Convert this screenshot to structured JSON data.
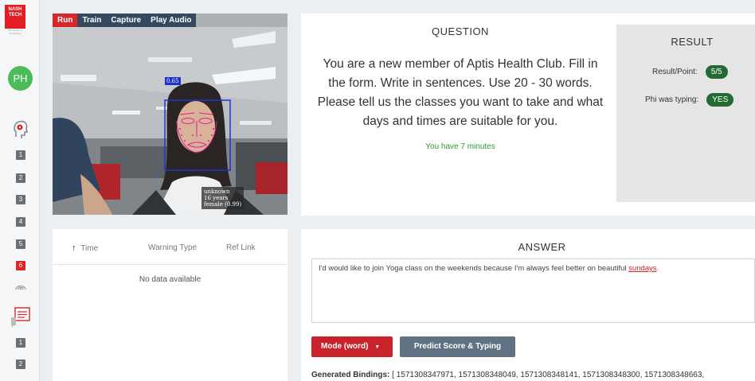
{
  "brand": {
    "logo_line1": "NASH",
    "logo_line2": "TECH",
    "tagline": "The Power of Technology"
  },
  "user": {
    "initials": "PH"
  },
  "sidebar": {
    "group1": [
      "1",
      "2",
      "3",
      "4",
      "5",
      "6"
    ],
    "group1_active": "6",
    "group2": [
      "1",
      "2"
    ]
  },
  "video": {
    "toolbar": [
      "Run",
      "Train",
      "Capture",
      "Play Audio"
    ],
    "face_score": "0.65",
    "identity": "unknown",
    "age": "16 years",
    "gender": "female (0.99)"
  },
  "question": {
    "title": "QUESTION",
    "text": "You are a new member of Aptis Health Club. Fill in the form. Write in sentences. Use 20 - 30 words. Please tell us the classes you want to take and what days and times are suitable for you.",
    "timer": "You have 7 minutes"
  },
  "result": {
    "title": "RESULT",
    "point_label": "Result/Point:",
    "point_value": "5/5",
    "typing_label": "Phi was typing:",
    "typing_value": "YES"
  },
  "warnings": {
    "col_time": "Time",
    "col_type": "Warning Type",
    "col_ref": "Ref Link",
    "empty": "No data available"
  },
  "answer": {
    "title": "ANSWER",
    "text_before": "I'd would like to join Yoga class on the weekends because I'm always feel better on beautiful ",
    "text_misspelled": "sundays",
    "text_after": ".",
    "mode_button": "Mode (word)",
    "predict_button": "Predict Score & Typing",
    "bindings_label": "Generated Bindings:",
    "bindings_value": "[ 1571308347971, 1571308348049, 1571308348141, 1571308348300, 1571308348663,"
  },
  "colors": {
    "accent": "#d8262b",
    "success": "#236b33",
    "avatar": "#4cbb5a"
  }
}
